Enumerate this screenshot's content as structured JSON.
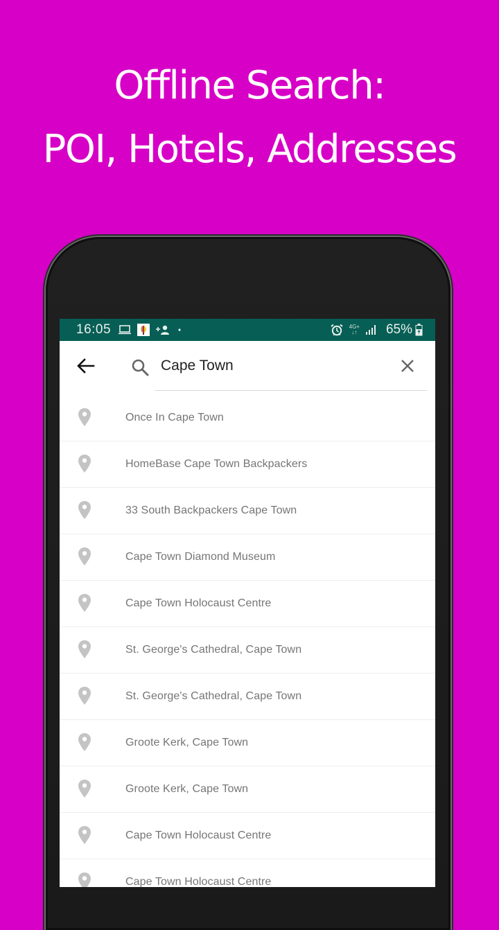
{
  "promo": {
    "line1": "Offline Search:",
    "line2": "POI, Hotels, Addresses",
    "background_color": "#d700c6"
  },
  "status_bar": {
    "time": "16:05",
    "left_icons": [
      "laptop-icon",
      "app-notification-icon",
      "add-contact-icon",
      "dot-icon"
    ],
    "right_icons": [
      "alarm-icon",
      "4g-data-icon",
      "signal-icon"
    ],
    "network": "4G+",
    "battery_percent": "65%",
    "color": "#075e54"
  },
  "toolbar": {
    "back_icon": "arrow-left-icon",
    "search_icon": "search-icon",
    "search_value": "Cape Town",
    "clear_icon": "close-icon"
  },
  "results": [
    {
      "icon": "map-pin-icon",
      "label": "Once In Cape Town"
    },
    {
      "icon": "map-pin-icon",
      "label": "HomeBase Cape Town Backpackers"
    },
    {
      "icon": "map-pin-icon",
      "label": "33 South Backpackers Cape Town"
    },
    {
      "icon": "map-pin-icon",
      "label": "Cape Town Diamond Museum"
    },
    {
      "icon": "map-pin-icon",
      "label": "Cape Town Holocaust Centre"
    },
    {
      "icon": "map-pin-icon",
      "label": "St. George's Cathedral, Cape Town"
    },
    {
      "icon": "map-pin-icon",
      "label": "St. George's Cathedral, Cape Town"
    },
    {
      "icon": "map-pin-icon",
      "label": "Groote Kerk, Cape Town"
    },
    {
      "icon": "map-pin-icon",
      "label": "Groote Kerk, Cape Town"
    },
    {
      "icon": "map-pin-icon",
      "label": "Cape Town Holocaust Centre"
    },
    {
      "icon": "map-pin-icon",
      "label": "Cape Town Holocaust Centre"
    }
  ]
}
